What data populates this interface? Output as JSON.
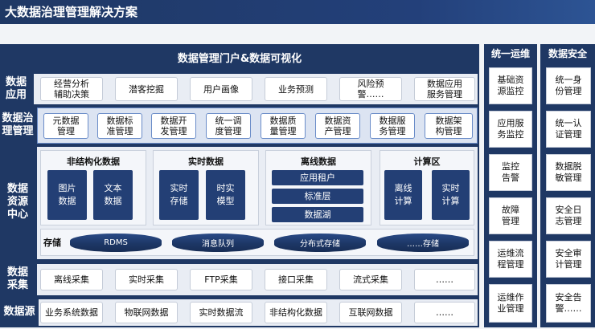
{
  "title": "大数据治理管理解决方案",
  "portal": {
    "label": "数据管理门户&数据可视化"
  },
  "application": {
    "label": "数据\n应用",
    "items": [
      "经营分析\n辅助决策",
      "潜客挖掘",
      "用户画像",
      "业务预测",
      "风险预\n警……",
      "数据应用\n服务管理"
    ]
  },
  "governance": {
    "label": "数据治\n理管理",
    "items": [
      "元数据\n管理",
      "数据标\n准管理",
      "数据开\n发管理",
      "统一调\n度管理",
      "数据质\n量管理",
      "数据资\n产管理",
      "数据服\n务管理",
      "数据架\n构管理"
    ]
  },
  "resource_center": {
    "label": "数据\n资源\n中心",
    "groups": {
      "unstructured": {
        "title": "非结构化数据",
        "items": [
          "图片\n数据",
          "文本\n数据"
        ]
      },
      "realtime": {
        "title": "实时数据",
        "items": [
          "实时\n存储",
          "时实\n模型"
        ]
      },
      "offline": {
        "title": "离线数据",
        "items": [
          "应用租户",
          "标准层",
          "数据湖"
        ]
      },
      "compute": {
        "title": "计算区",
        "items": [
          "离线\n计算",
          "实时\n计算"
        ]
      }
    },
    "storage": {
      "label": "存储",
      "items": [
        "RDMS",
        "消息队列",
        "分布式存储",
        "……存储"
      ]
    }
  },
  "collection": {
    "label": "数据\n采集",
    "items": [
      "离线采集",
      "实时采集",
      "FTP采集",
      "接口采集",
      "流式采集",
      "……"
    ]
  },
  "sources": {
    "label": "数据源",
    "items": [
      "业务系统数据",
      "物联网数据",
      "实时数据流",
      "非结构化数据",
      "互联网数据",
      "……"
    ]
  },
  "ops": {
    "title": "统一运维",
    "items": [
      "基础资\n源监控",
      "应用服\n务监控",
      "监控\n告警",
      "故障\n管理",
      "运维流\n程管理",
      "运维作\n业管理"
    ]
  },
  "security": {
    "title": "数据安全",
    "items": [
      "统一身\n份管理",
      "统一认\n证管理",
      "数据脱\n敏管理",
      "安全日\n志管理",
      "安全审\n计管理",
      "安全告\n警……"
    ]
  }
}
